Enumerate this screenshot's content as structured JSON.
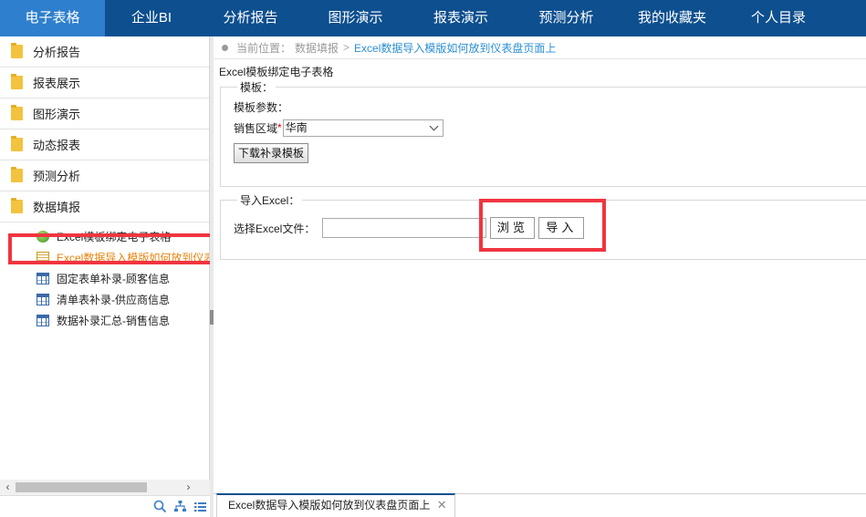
{
  "topnav": {
    "tabs": [
      {
        "label": "电子表格",
        "active": true
      },
      {
        "label": "企业BI",
        "active": false
      },
      {
        "label": "分析报告",
        "active": false
      },
      {
        "label": "图形演示",
        "active": false
      },
      {
        "label": "报表演示",
        "active": false
      },
      {
        "label": "预测分析",
        "active": false
      },
      {
        "label": "我的收藏夹",
        "active": false
      },
      {
        "label": "个人目录",
        "active": false
      }
    ]
  },
  "sidebar": {
    "folders": [
      {
        "label": "分析报告",
        "icon": "folder-icon"
      },
      {
        "label": "报表展示",
        "icon": "folder-icon"
      },
      {
        "label": "图形演示",
        "icon": "folder-icon"
      },
      {
        "label": "动态报表",
        "icon": "folder-icon"
      },
      {
        "label": "预测分析",
        "icon": "folder-icon"
      },
      {
        "label": "数据填报",
        "icon": "folder-icon"
      }
    ],
    "children": [
      {
        "label": "Excel模板绑定电子表格",
        "icon": "globe-icon",
        "selected": false
      },
      {
        "label": "Excel数据导入模版如何放到仪表盘页面上",
        "icon": "document-icon",
        "selected": true
      },
      {
        "label": "固定表单补录-顾客信息",
        "icon": "table-grid-icon",
        "selected": false
      },
      {
        "label": "清单表补录-供应商信息",
        "icon": "table-grid-icon",
        "selected": false
      },
      {
        "label": "数据补录汇总-销售信息",
        "icon": "table-grid-icon",
        "selected": false
      }
    ],
    "scroll_left": "‹",
    "scroll_right": "›",
    "bottom_icons": [
      "search-icon",
      "tree-icon",
      "list-icon"
    ]
  },
  "breadcrumb": {
    "prefix": "当前位置：",
    "parent": "数据填报",
    "separator": ">",
    "current": "Excel数据导入模版如何放到仪表盘页面上"
  },
  "main": {
    "section_title": "Excel模板绑定电子表格",
    "template_fieldset": {
      "legend": "模板：",
      "params_label": "模板参数：",
      "region_label": "销售区域",
      "required_mark": "*",
      "region_value": "华南",
      "download_button": "下载补录模板"
    },
    "import_fieldset": {
      "legend": "导入Excel：",
      "file_label": "选择Excel文件：",
      "file_value": "",
      "browse_button": "浏览",
      "import_button": "导入"
    }
  },
  "tabbar": {
    "tab_label": "Excel数据导入模版如何放到仪表盘页面上",
    "close": "✕"
  },
  "colors": {
    "nav_bg": "#0d4f8f",
    "nav_active": "#2e7fcd",
    "highlight_box": "#f0353f",
    "selected_text": "#e8820c",
    "breadcrumb_link": "#2c8fd3"
  }
}
